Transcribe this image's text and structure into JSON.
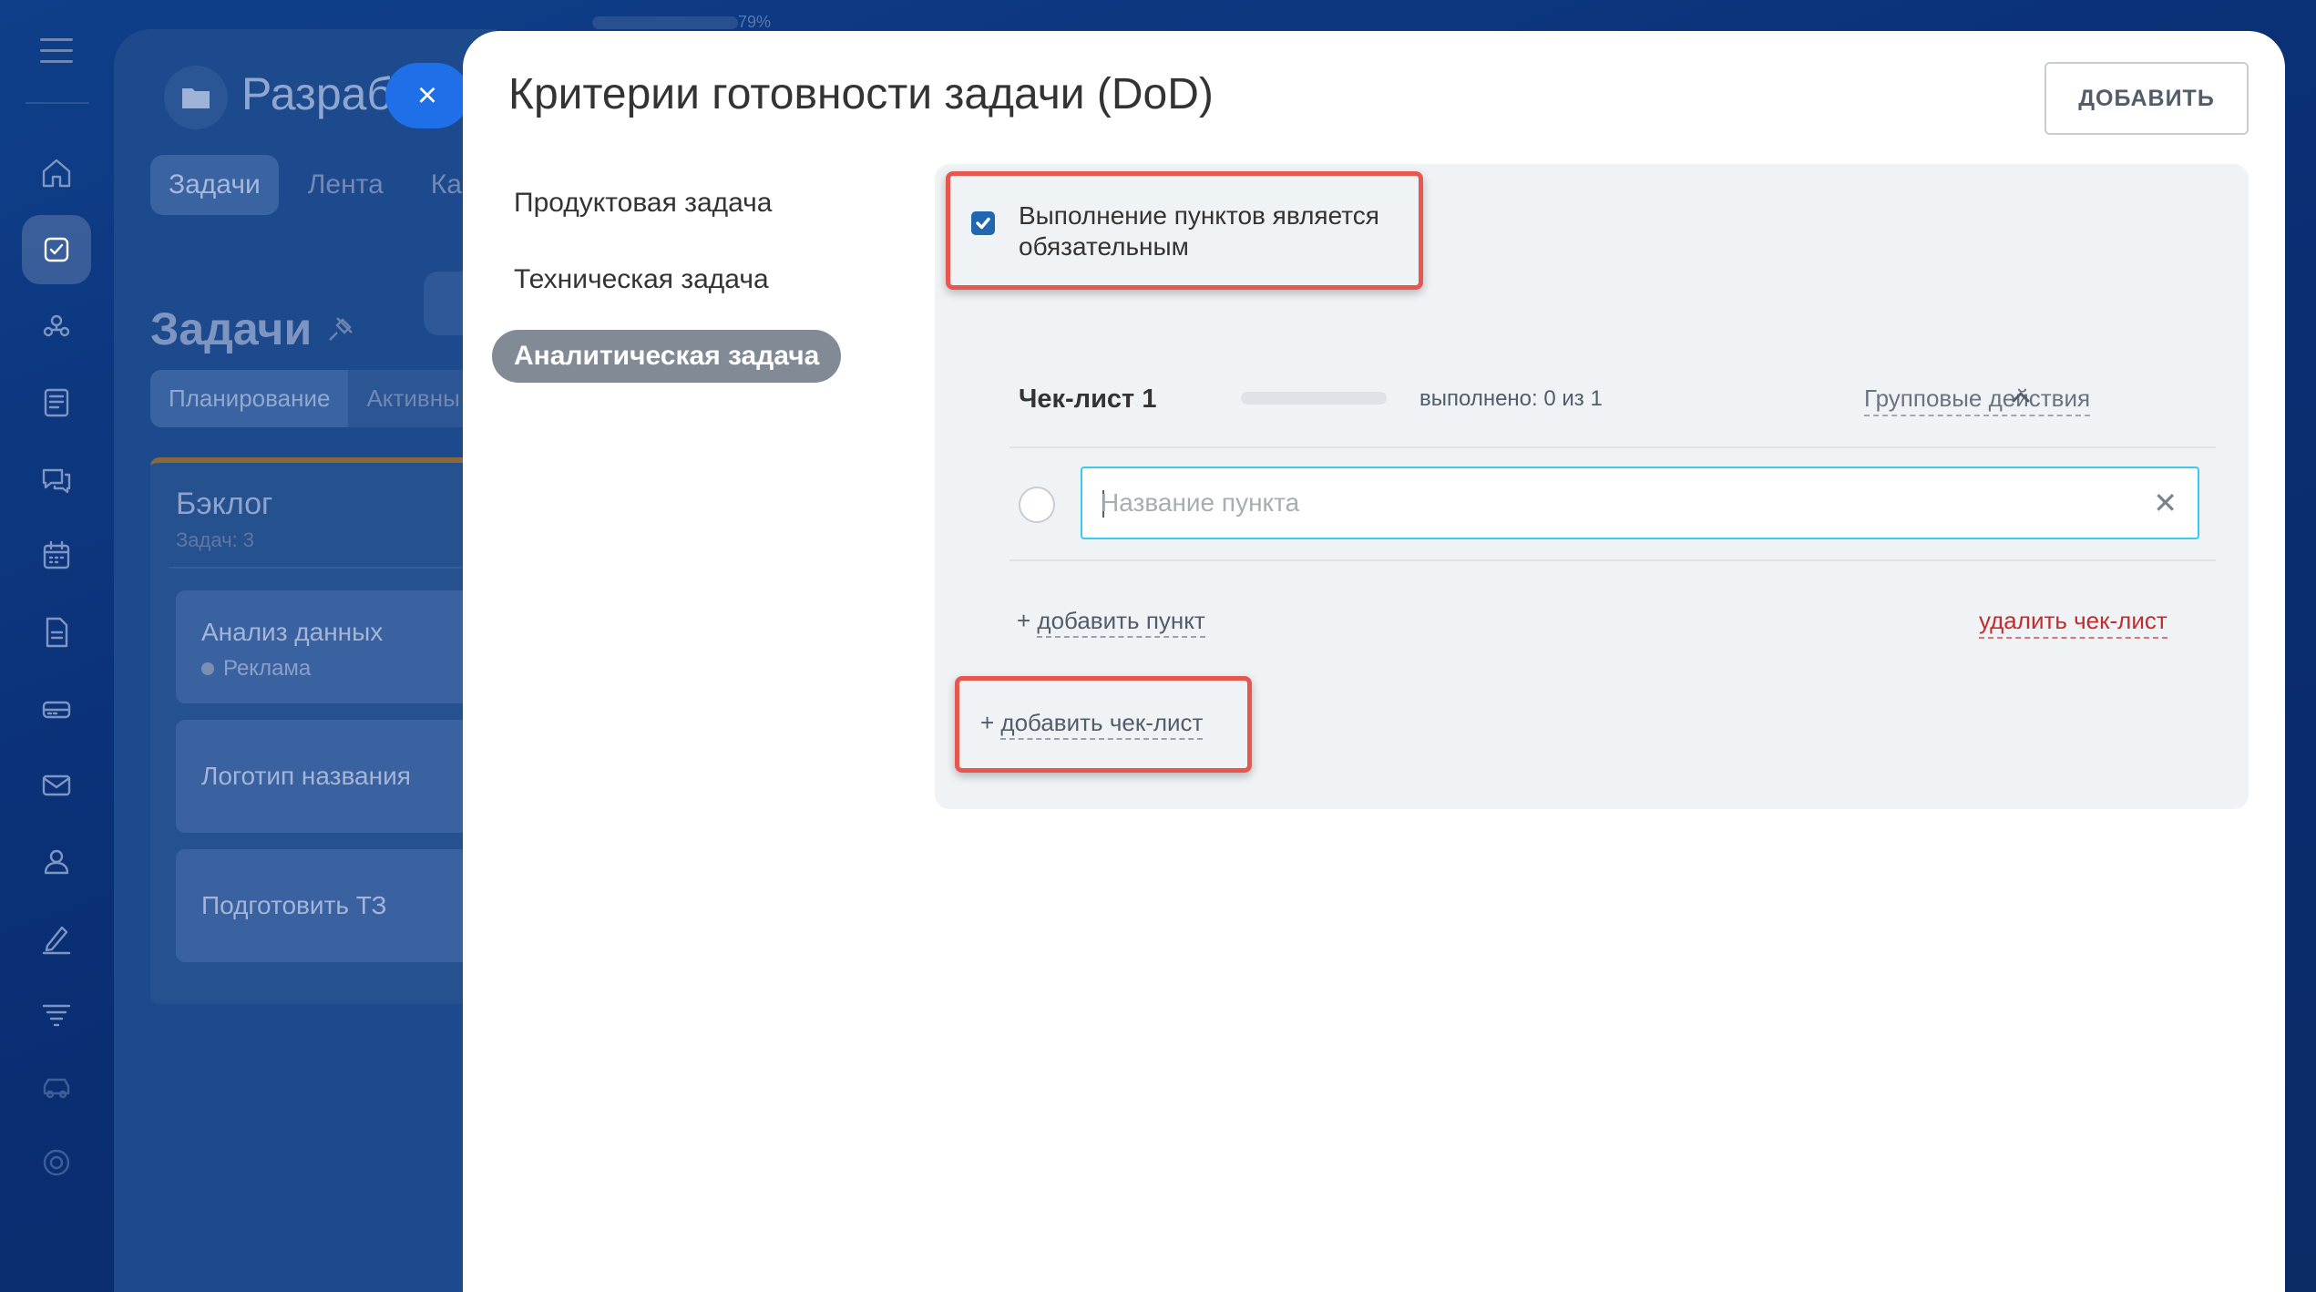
{
  "background_app": {
    "project_title": "Разраб",
    "tabs": [
      "Задачи",
      "Лента",
      "Ка"
    ],
    "tasks_heading": "Задачи",
    "subtabs": [
      "Планирование",
      "Активны"
    ],
    "column": {
      "title": "Бэклог",
      "count": "Задач: 3",
      "cards": [
        {
          "title": "Анализ данных",
          "tag": "Реклама"
        },
        {
          "title": "Логотип названия"
        },
        {
          "title": "Подготовить ТЗ"
        }
      ]
    },
    "zoom": "79%"
  },
  "sidebar_icons": [
    "home-icon",
    "tasks-icon",
    "people-icon",
    "feed-icon",
    "chat-icon",
    "calendar-icon",
    "document-icon",
    "drive-icon",
    "mail-icon",
    "contacts-icon",
    "sign-icon",
    "filter-icon",
    "car-icon",
    "settings-icon"
  ],
  "dialog": {
    "close_label": "×",
    "title": "Критерии готовности задачи (DoD)",
    "add_button": "ДОБАВИТЬ",
    "task_types": [
      {
        "label": "Продуктовая задача",
        "active": false
      },
      {
        "label": "Техническая задача",
        "active": false
      },
      {
        "label": "Аналитическая задача",
        "active": true
      }
    ],
    "required_checkbox": {
      "label": "Выполнение пунктов является обязательным",
      "checked": true
    },
    "checklist": {
      "title": "Чек-лист 1",
      "progress": {
        "done": 0,
        "total": 1,
        "text": "выполнено: 0 из 1"
      },
      "group_actions": "Групповые действия",
      "item_placeholder": "Название пункта",
      "add_item": "добавить пункт",
      "delete_checklist": "удалить чек-лист"
    },
    "add_checklist": "добавить чек-лист",
    "plus": "+"
  },
  "colors": {
    "accent_blue": "#1f6fe8",
    "highlight_red": "#e8574f",
    "danger_text": "#c42b2b",
    "input_focus": "#3bc8f5"
  }
}
